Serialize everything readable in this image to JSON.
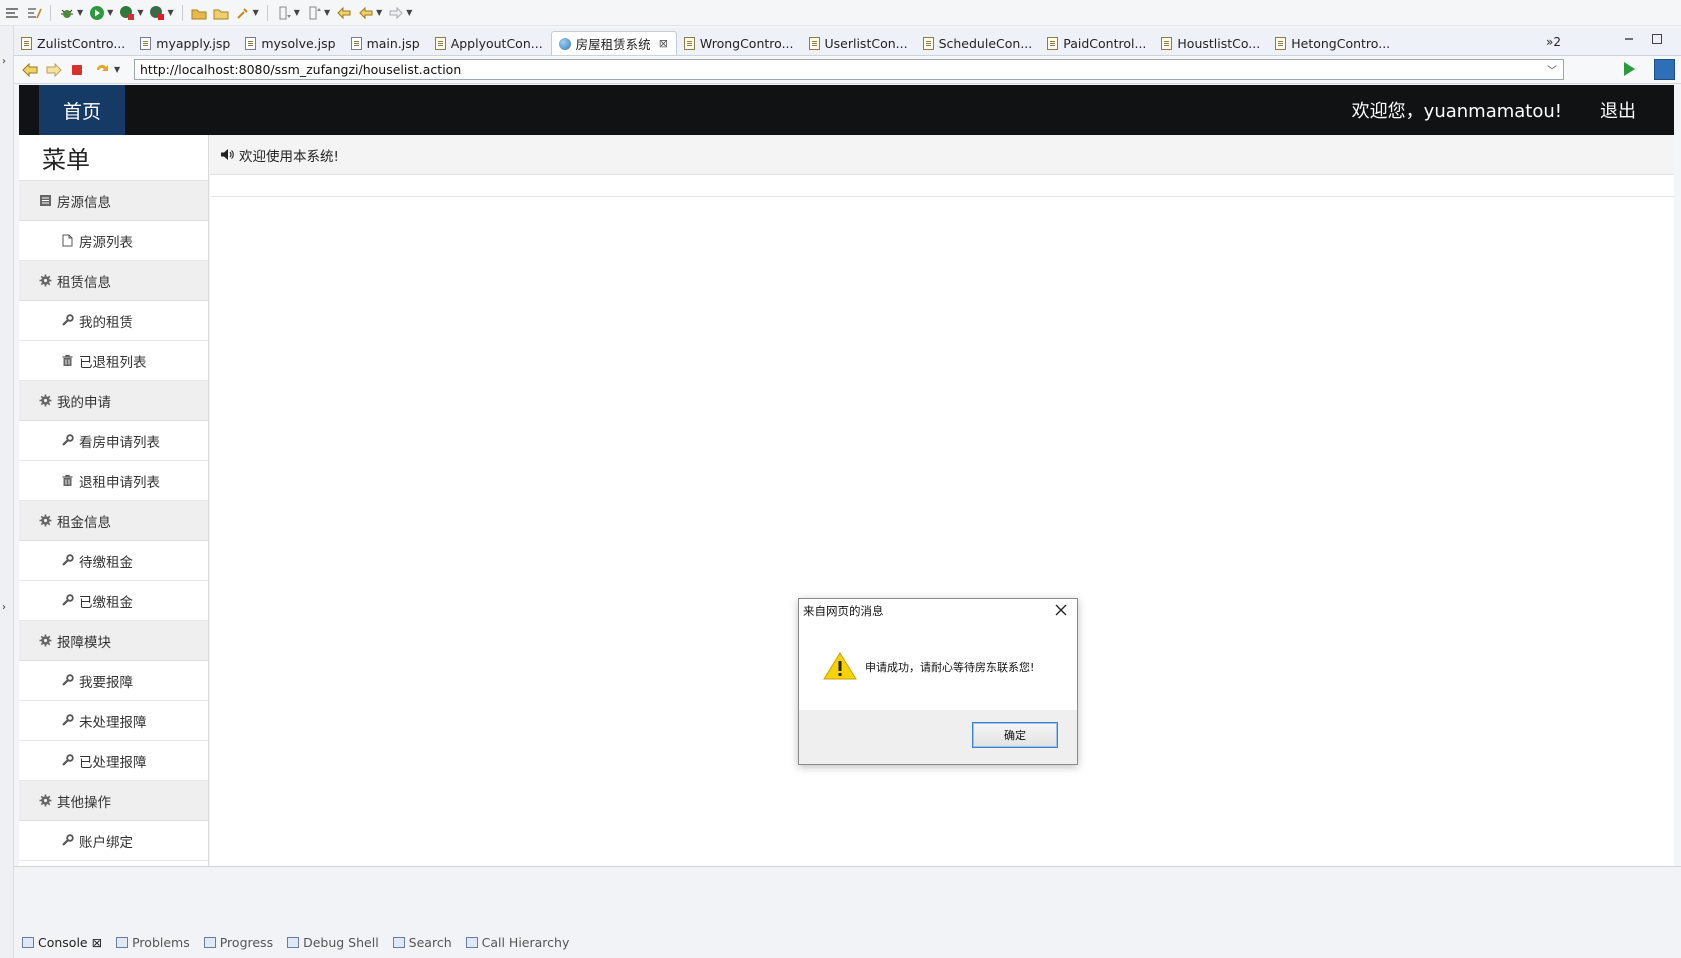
{
  "ide": {
    "tabs": [
      {
        "label": "ZulistContro...",
        "icon": "java-file-icon",
        "active": false
      },
      {
        "label": "myapply.jsp",
        "icon": "jsp-file-icon",
        "active": false
      },
      {
        "label": "mysolve.jsp",
        "icon": "jsp-file-icon",
        "active": false
      },
      {
        "label": "main.jsp",
        "icon": "jsp-file-icon",
        "active": false
      },
      {
        "label": "ApplyoutCon...",
        "icon": "java-file-icon",
        "active": false
      },
      {
        "label": "房屋租赁系统",
        "icon": "globe-icon",
        "active": true
      },
      {
        "label": "WrongContro...",
        "icon": "java-file-icon",
        "active": false
      },
      {
        "label": "UserlistCon...",
        "icon": "java-file-icon",
        "active": false
      },
      {
        "label": "ScheduleCon...",
        "icon": "java-file-icon",
        "active": false
      },
      {
        "label": "PaidControl...",
        "icon": "java-file-icon",
        "active": false
      },
      {
        "label": "HoustlistCo...",
        "icon": "java-file-icon",
        "active": false
      },
      {
        "label": "HetongContro...",
        "icon": "java-file-icon",
        "active": false
      }
    ],
    "tab_overflow": "»2",
    "tab_close_glyph": "⊠",
    "url": "http://localhost:8080/ssm_zufangzi/houselist.action",
    "bottom_tabs": [
      {
        "label": "Console",
        "active": true,
        "close": "⊠"
      },
      {
        "label": "Problems",
        "active": false
      },
      {
        "label": "Progress",
        "active": false
      },
      {
        "label": "Debug Shell",
        "active": false
      },
      {
        "label": "Search",
        "active": false
      },
      {
        "label": "Call Hierarchy",
        "active": false
      }
    ]
  },
  "header": {
    "home": "首页",
    "welcome": "欢迎您，yuanmamatou!",
    "logout": "退出"
  },
  "sidebar": {
    "title": "菜单",
    "groups": [
      {
        "label": "房源信息",
        "icon": "list-icon",
        "items": [
          {
            "label": "房源列表",
            "icon": "file-icon"
          }
        ]
      },
      {
        "label": "租赁信息",
        "icon": "gear-icon",
        "items": [
          {
            "label": "我的租赁",
            "icon": "wrench-icon"
          },
          {
            "label": "已退租列表",
            "icon": "trash-icon"
          }
        ]
      },
      {
        "label": "我的申请",
        "icon": "gear-icon",
        "items": [
          {
            "label": "看房申请列表",
            "icon": "wrench-icon"
          },
          {
            "label": "退租申请列表",
            "icon": "trash-icon"
          }
        ]
      },
      {
        "label": "租金信息",
        "icon": "gear-icon",
        "items": [
          {
            "label": "待缴租金",
            "icon": "wrench-icon"
          },
          {
            "label": "已缴租金",
            "icon": "wrench-icon"
          }
        ]
      },
      {
        "label": "报障模块",
        "icon": "gear-icon",
        "items": [
          {
            "label": "我要报障",
            "icon": "wrench-icon"
          },
          {
            "label": "未处理报障",
            "icon": "wrench-icon"
          },
          {
            "label": "已处理报障",
            "icon": "wrench-icon"
          }
        ]
      },
      {
        "label": "其他操作",
        "icon": "gear-icon",
        "items": [
          {
            "label": "账户绑定",
            "icon": "wrench-icon"
          }
        ]
      }
    ]
  },
  "content": {
    "notice": "欢迎使用本系统!"
  },
  "dialog": {
    "title": "来自网页的消息",
    "message": "申请成功，请耐心等待房东联系您!",
    "ok": "确定"
  },
  "colors": {
    "header_bg": "#111214",
    "home_tab_bg": "#163a66",
    "warning_yellow": "#f5d200"
  }
}
